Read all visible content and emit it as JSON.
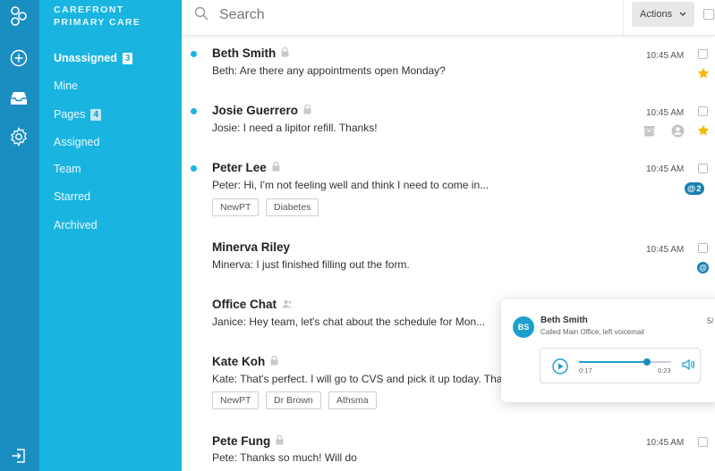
{
  "brand": {
    "line1": "CAREFRONT",
    "line2": "PRIMARY CARE"
  },
  "rail": {
    "icons": [
      "logo-icon",
      "add-icon",
      "inbox-icon",
      "settings-icon",
      "logout-icon"
    ]
  },
  "nav": {
    "items": [
      {
        "label": "Unassigned",
        "badge": "3"
      },
      {
        "label": "Mine",
        "badge": ""
      },
      {
        "label": "Pages",
        "badge": "4"
      },
      {
        "label": "Assigned",
        "badge": ""
      },
      {
        "label": "Team",
        "badge": ""
      },
      {
        "label": "Starred",
        "badge": ""
      },
      {
        "label": "Archived",
        "badge": ""
      }
    ]
  },
  "search": {
    "placeholder": "Search"
  },
  "toolbar": {
    "actions_label": "Actions"
  },
  "conversations": [
    {
      "name": "Beth Smith",
      "preview": "Beth: Are there any appointments open Monday?",
      "time": "10:45 AM",
      "unread": true,
      "starred": true,
      "tags": [],
      "mentions": ""
    },
    {
      "name": "Josie Guerrero",
      "preview": "Josie: I need a lipitor refill. Thanks!",
      "time": "10:45 AM",
      "unread": true,
      "starred": true,
      "tags": [],
      "mentions": ""
    },
    {
      "name": "Peter Lee",
      "preview": "Peter: Hi, I'm not feeling well and think I need to come in...",
      "time": "10:45 AM",
      "unread": true,
      "starred": false,
      "tags": [
        "NewPT",
        "Diabetes"
      ],
      "mentions": "2"
    },
    {
      "name": "Minerva Riley",
      "preview": "Minerva: I just finished filling out the form.",
      "time": "10:45 AM",
      "unread": false,
      "starred": false,
      "tags": [],
      "mentions": ""
    },
    {
      "name": "Office Chat",
      "preview": "Janice: Hey team, let's chat about the schedule for Mon...",
      "time": "",
      "unread": false,
      "starred": false,
      "tags": [],
      "mentions": ""
    },
    {
      "name": "Kate Koh",
      "preview": "Kate: That's perfect. I will go to CVS and pick it up today. Than",
      "time": "",
      "unread": false,
      "starred": false,
      "tags": [
        "NewPT",
        "Dr Brown",
        "Athsma"
      ],
      "mentions": ""
    },
    {
      "name": "Pete Fung",
      "preview": "Pete: Thanks so much! Will do",
      "time": "10:45 AM",
      "unread": false,
      "starred": false,
      "tags": [],
      "mentions": ""
    }
  ],
  "voicemail": {
    "initials": "BS",
    "name": "Beth Smith",
    "description": "Called Main Office, left voicemail",
    "date": "5/",
    "current_time": "0:17",
    "duration": "0:23",
    "progress": 0.74
  },
  "colors": {
    "rail": "#1a8ec1",
    "nav": "#19b5e0",
    "star": "#f5b800",
    "accent": "#1aa0cf"
  }
}
